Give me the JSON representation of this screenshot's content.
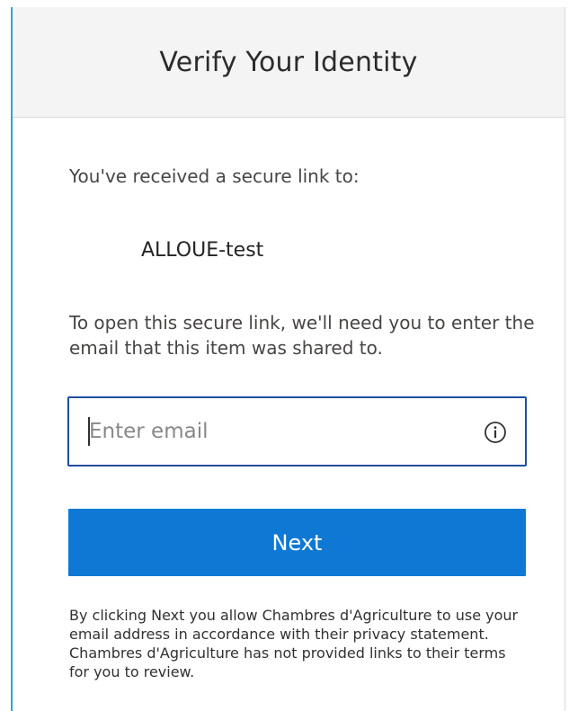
{
  "header": {
    "title": "Verify Your Identity"
  },
  "main": {
    "received_text": "You've received a secure link to:",
    "item_name": "ALLOUE-test",
    "instructions": "To open this secure link, we'll need you to enter the email that this item was shared to.",
    "email": {
      "value": "",
      "placeholder": "Enter email",
      "info_icon": "info-icon"
    },
    "next_label": "Next",
    "disclaimer": "By clicking Next you allow Chambres d'Agriculture to use your email address in accordance with their privacy statement. Chambres d'Agriculture has not provided links to their terms for you to review."
  },
  "colors": {
    "accent": "#0f78d4",
    "input_border": "#1f4e9e",
    "header_bg": "#f4f4f4",
    "left_accent": "#3aa3c7"
  }
}
